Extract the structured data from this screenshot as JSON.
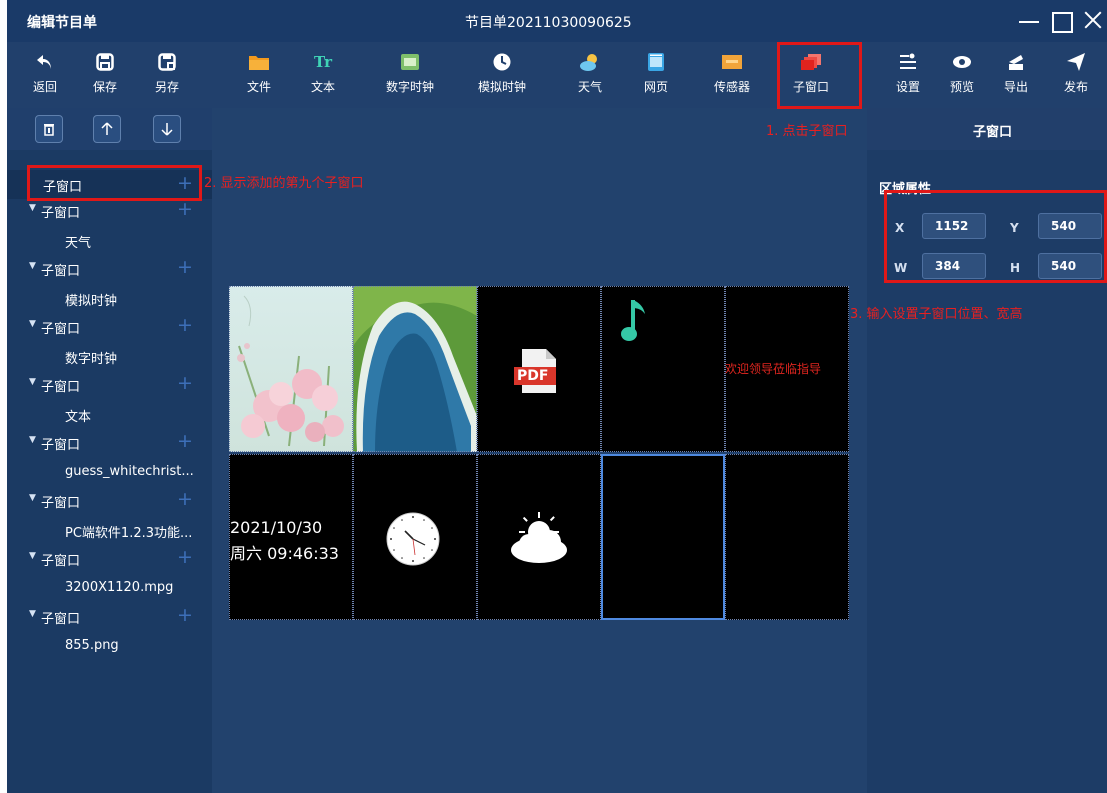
{
  "window": {
    "app_title": "编辑节目单",
    "document_title": "节目单20211030090625"
  },
  "toolbar": {
    "back": "返回",
    "save": "保存",
    "save_as": "另存",
    "file": "文件",
    "text": "文本",
    "digital_clock": "数字时钟",
    "analog_clock": "模拟时钟",
    "weather": "天气",
    "webpage": "网页",
    "sensor": "传感器",
    "sub_window": "子窗口",
    "settings": "设置",
    "preview": "预览",
    "export": "导出",
    "publish": "发布",
    "text_icon_glyph": "Tr"
  },
  "tree": {
    "selected_item": "子窗口",
    "items": [
      {
        "name": "子窗口",
        "child": "天气"
      },
      {
        "name": "子窗口",
        "child": "模拟时钟"
      },
      {
        "name": "子窗口",
        "child": "数字时钟"
      },
      {
        "name": "子窗口",
        "child": "文本"
      },
      {
        "name": "子窗口",
        "child": "guess_whitechrist..."
      },
      {
        "name": "子窗口",
        "child": "PC端软件1.2.3功能..."
      },
      {
        "name": "子窗口",
        "child": "3200X1120.mpg"
      },
      {
        "name": "子窗口",
        "child": "855.png"
      }
    ]
  },
  "preview": {
    "pdf_label": "PDF",
    "marquee_text": "欢迎领导莅临指导",
    "date": "2021/10/30",
    "weekday_time": "周六 09:46:33"
  },
  "right_panel": {
    "title": "子窗口",
    "section": "区域属性",
    "x_label": "X",
    "x_value": "1152",
    "y_label": "Y",
    "y_value": "540",
    "w_label": "W",
    "w_value": "384",
    "h_label": "H",
    "h_value": "540"
  },
  "annotations": {
    "step1": "1. 点击子窗口",
    "step2": "2. 显示添加的第九个子窗口",
    "step3": "3. 输入设置子窗口位置、宽高"
  },
  "colors": {
    "background": "#21406c",
    "annotation_red": "#e01818",
    "selection_blue": "#4f8ae0"
  }
}
